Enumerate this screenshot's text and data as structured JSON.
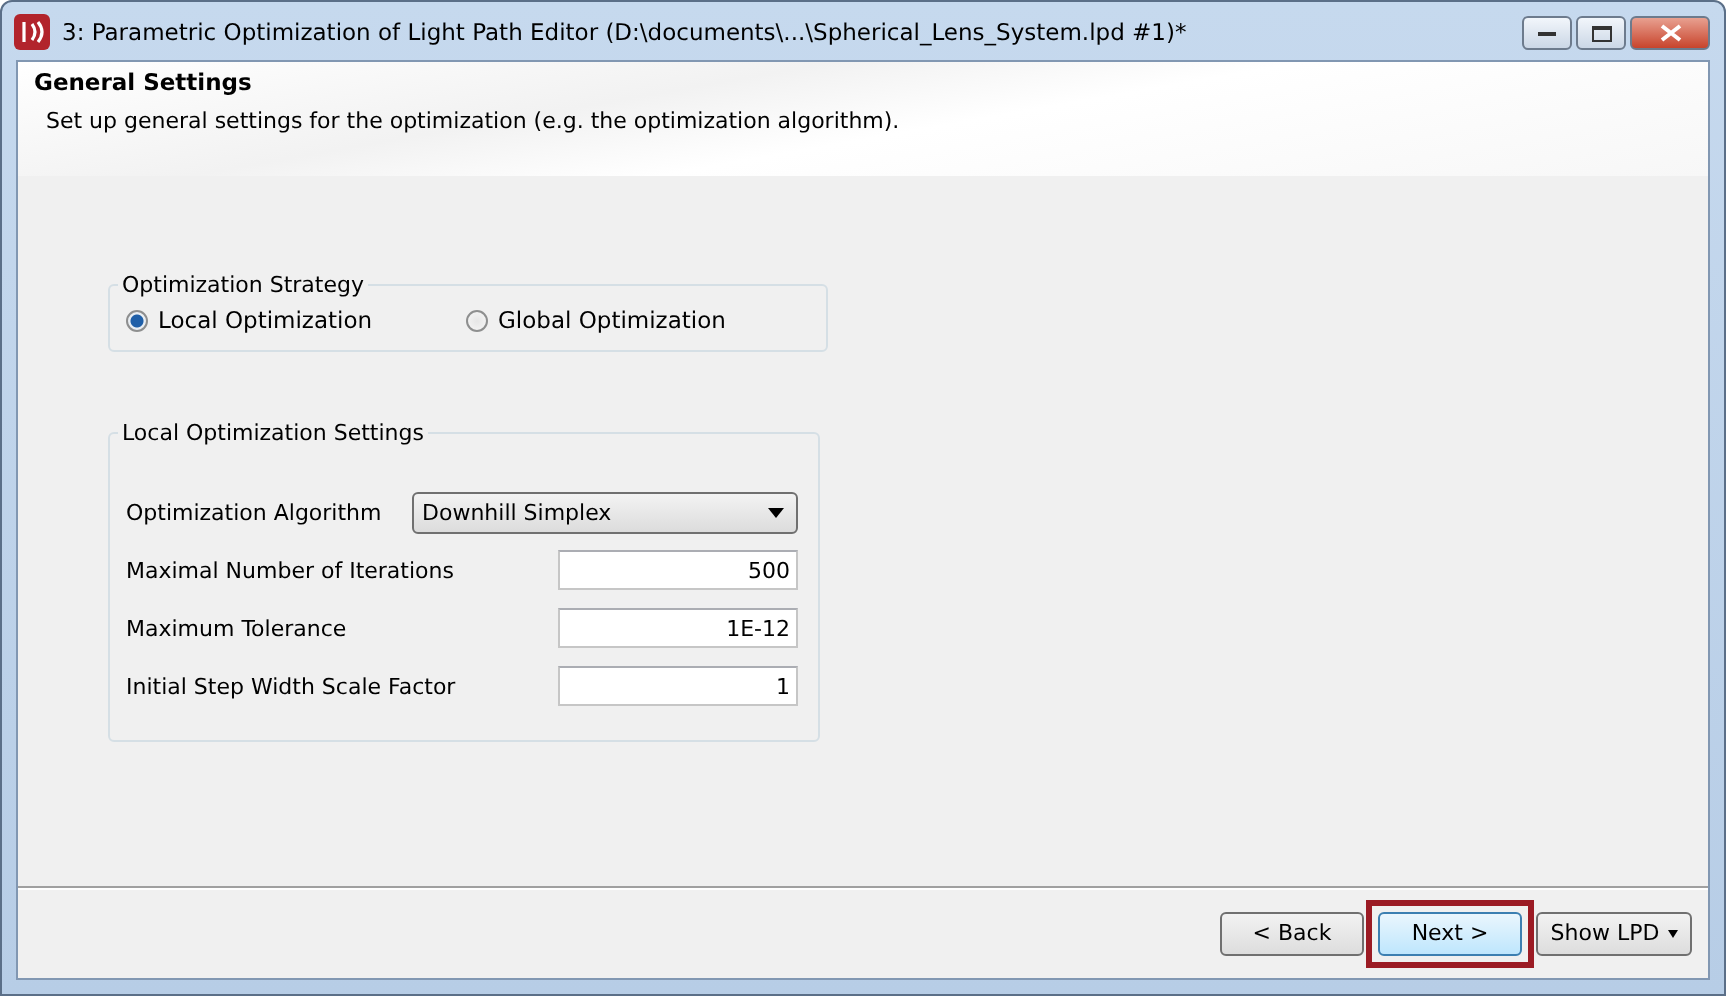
{
  "window": {
    "title": "3: Parametric Optimization of Light Path Editor (D:\\documents\\...\\Spherical_Lens_System.lpd #1)*"
  },
  "header": {
    "title": "General Settings",
    "description": "Set up general settings for the optimization (e.g. the optimization algorithm)."
  },
  "strategy": {
    "legend": "Optimization Strategy",
    "options": [
      {
        "label": "Local Optimization",
        "selected": true
      },
      {
        "label": "Global Optimization",
        "selected": false
      }
    ]
  },
  "local_settings": {
    "legend": "Local Optimization Settings",
    "algorithm": {
      "label": "Optimization Algorithm",
      "value": "Downhill Simplex"
    },
    "fields": [
      {
        "label": "Maximal Number of Iterations",
        "value": "500"
      },
      {
        "label": "Maximum Tolerance",
        "value": "1E-12"
      },
      {
        "label": "Initial Step Width Scale Factor",
        "value": "1"
      }
    ]
  },
  "buttons": [
    {
      "label": "< Back",
      "kind": "plain",
      "default": false,
      "highlighted": false
    },
    {
      "label": "Next >",
      "kind": "plain",
      "default": true,
      "highlighted": true
    },
    {
      "label": "Show LPD",
      "kind": "menu",
      "default": false,
      "highlighted": false
    }
  ]
}
